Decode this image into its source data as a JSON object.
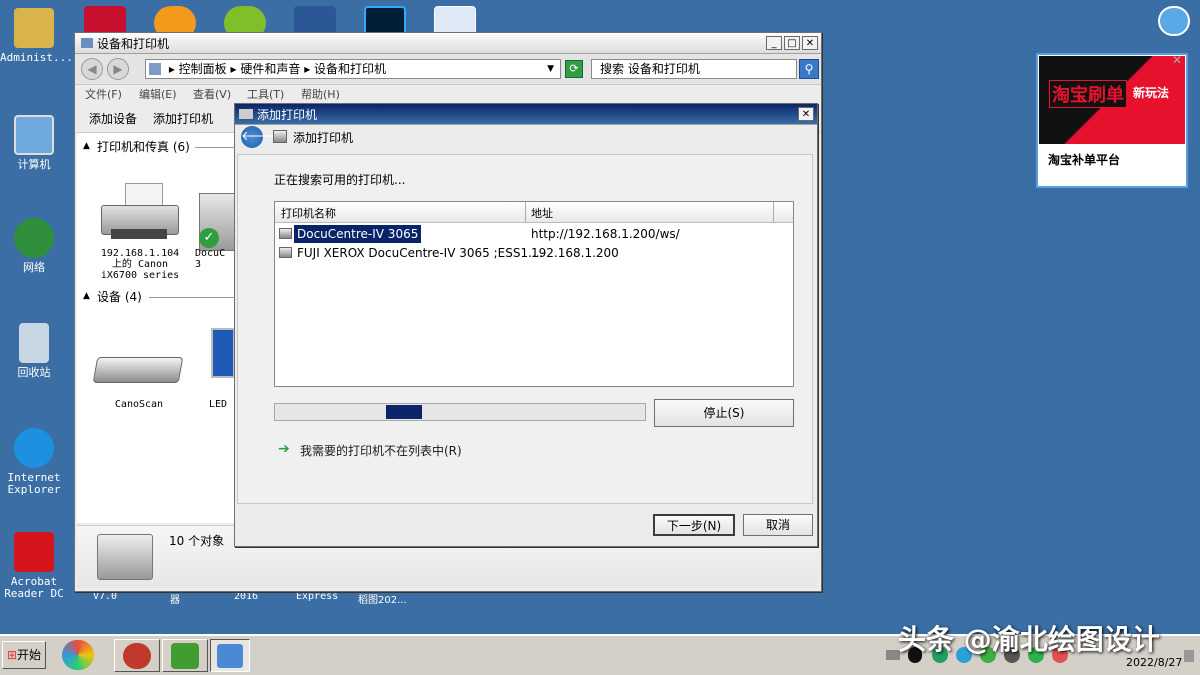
{
  "desktop": {
    "icons": [
      {
        "label": "Administ..."
      },
      {
        "label": "计算机"
      },
      {
        "label": "网络"
      },
      {
        "label": "回收站"
      },
      {
        "label": "Internet Explorer"
      },
      {
        "label": "Acrobat Reader DC"
      }
    ],
    "bottom_labels": [
      "V7.0",
      "器",
      "2016",
      "Express",
      "稻图202..."
    ]
  },
  "explorer": {
    "title": "设备和打印机",
    "breadcrumb": [
      "控制面板",
      "硬件和声音",
      "设备和打印机"
    ],
    "search_placeholder": "搜索 设备和打印机",
    "menu": [
      "文件(F)",
      "编辑(E)",
      "查看(V)",
      "工具(T)",
      "帮助(H)"
    ],
    "toolbar": [
      "添加设备",
      "添加打印机"
    ],
    "printers_section": "打印机和传真 (6)",
    "devices_section": "设备 (4)",
    "printer1_label": "192.168.1.104\n上的 Canon\niX6700 series",
    "printer2_label": "DocuC\n3",
    "scanner_label": "CanoScan",
    "led_label": "LED",
    "status_count": "10 个对象"
  },
  "dialog": {
    "title": "添加打印机",
    "header": "添加打印机",
    "searching": "正在搜索可用的打印机...",
    "columns": [
      "打印机名称",
      "地址"
    ],
    "rows": [
      {
        "name": "DocuCentre-IV 3065",
        "address": "http://192.168.1.200/ws/"
      },
      {
        "name": "FUJI XEROX DocuCentre-IV 3065 ;ESS1....",
        "address": "192.168.1.200"
      }
    ],
    "progress": 0.3,
    "stop_button": "停止(S)",
    "not_listed": "我需要的打印机不在列表中(R)",
    "next_button": "下一步(N)",
    "cancel_button": "取消"
  },
  "ad": {
    "banner_text": "淘宝刷单",
    "banner_small": "新玩法",
    "caption": "淘宝补单平台"
  },
  "taskbar": {
    "start_label": "开始",
    "date": "2022/8/27"
  },
  "watermark": "头条 @渝北绘图设计",
  "colors": {
    "desktop": "#3a6ea5",
    "selection": "#0a246a",
    "progress": "#0a246a",
    "ad_red": "#e8112d"
  }
}
